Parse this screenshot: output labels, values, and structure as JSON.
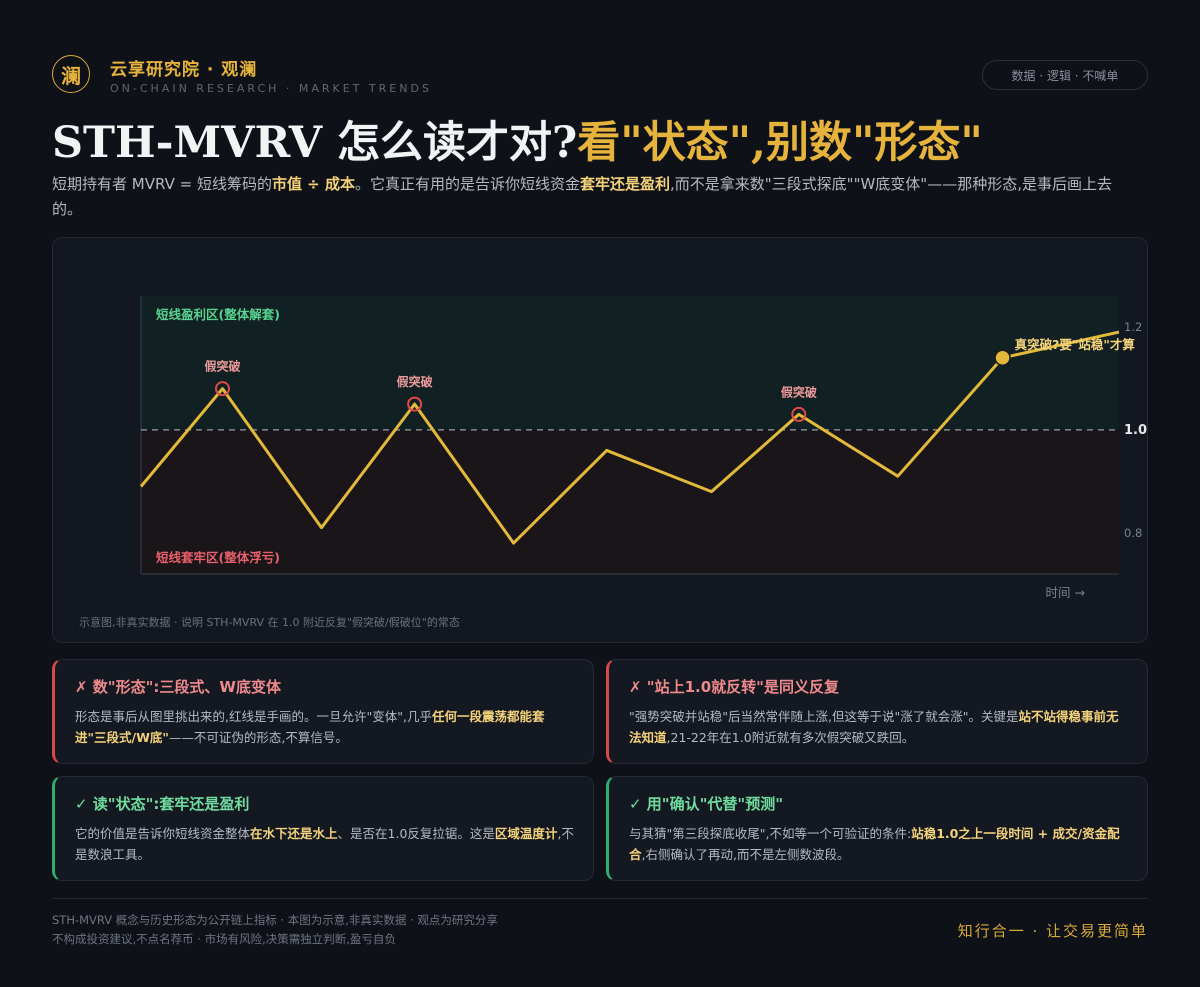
{
  "header": {
    "logo_char": "澜",
    "brand": "云享研究院 · 观澜",
    "brand_sub": "ON-CHAIN RESEARCH · MARKET TRENDS",
    "tag": "数据 · 逻辑 · 不喊单"
  },
  "title": {
    "part1": "STH-MVRV 怎么读才对?",
    "part2": "看\"状态\",别数\"形态\""
  },
  "subtitle": {
    "s1": "短期持有者 MVRV = 短线筹码的",
    "b1": "市值 ÷ 成本",
    "s2": "。它真正有用的是告诉你短线资金",
    "b2": "套牢还是盈利",
    "s3": ",而不是拿来数\"三段式探底\"\"W底变体\"——那种形态,是事后画上去的。"
  },
  "chart_data": {
    "type": "line",
    "title": "",
    "xlabel": "时间 →",
    "ylabel": "",
    "ylim": [
      0.72,
      1.26
    ],
    "yticks": [
      0.8,
      1.0,
      1.2
    ],
    "ytick_labels": [
      "0.8",
      "1.0",
      "1.2"
    ],
    "reference_line": 1.0,
    "zone_labels": {
      "upper": "短线盈利区(整体解套)",
      "lower": "短线套牢区(整体浮亏)"
    },
    "series": [
      {
        "values": [
          0.89,
          1.08,
          0.81,
          1.05,
          0.78,
          0.96,
          0.88,
          1.03,
          0.91,
          1.14,
          1.19
        ],
        "x": [
          0,
          0.7,
          1.55,
          2.35,
          3.2,
          4.0,
          4.9,
          5.65,
          6.5,
          7.4,
          8.4
        ]
      }
    ],
    "annotations": [
      {
        "index": 1,
        "text": "假突破",
        "kind": "false"
      },
      {
        "index": 3,
        "text": "假突破",
        "kind": "false"
      },
      {
        "index": 7,
        "text": "假突破",
        "kind": "false"
      },
      {
        "index": 9,
        "text": "真突破?要\"站稳\"才算",
        "kind": "true"
      }
    ],
    "caption": "示意图,非真实数据 · 说明 STH-MVRV 在 1.0 附近反复\"假突破/假破位\"的常态",
    "colors": {
      "line": "#e3b93a",
      "false_marker": "#e04a4a",
      "upper_zone": "#112022",
      "lower_zone": "#1a1519",
      "upper_label": "#57d38f",
      "lower_label": "#e8606a"
    }
  },
  "cards": [
    {
      "title": "✗ 数\"形态\":三段式、W底变体",
      "t1": "形态是事后从图里挑出来的,红线是手画的。一旦允许\"变体\",几乎",
      "b1": "任何一段震荡都能套进\"三段式/W底\"",
      "t2": "——不可证伪的形态,不算信号。"
    },
    {
      "title": "✗ \"站上1.0就反转\"是同义反复",
      "t1": "\"强势突破并站稳\"后当然常伴随上涨,但这等于说\"涨了就会涨\"。关键是",
      "b1": "站不站得稳事前无法知道",
      "t2": ",21-22年在1.0附近就有多次假突破又跌回。"
    },
    {
      "title": "✓ 读\"状态\":套牢还是盈利",
      "t1": "它的价值是告诉你短线资金整体",
      "b1": "在水下还是水上",
      "t2": "、是否在1.0反复拉锯。这是",
      "b2": "区域温度计",
      "t3": ",不是数浪工具。"
    },
    {
      "title": "✓ 用\"确认\"代替\"预测\"",
      "t1": "与其猜\"第三段探底收尾\",不如等一个可验证的条件:",
      "b1": "站稳1.0之上一段时间 + 成交/资金配合",
      "t2": ",右侧确认了再动,而不是左侧数波段。"
    }
  ],
  "footer": {
    "line1": "STH-MVRV 概念与历史形态为公开链上指标 · 本图为示意,非真实数据 · 观点为研究分享",
    "line2": "不构成投资建议,不点名荐币 · 市场有风险,决策需独立判断,盈亏自负",
    "slogan": "知行合一 · 让交易更简单"
  }
}
